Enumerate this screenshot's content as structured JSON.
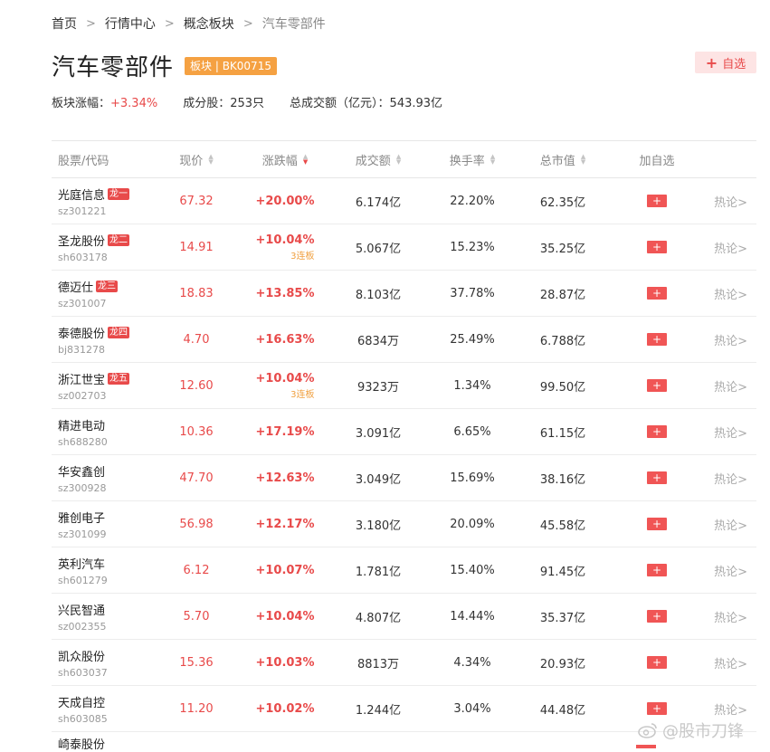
{
  "breadcrumb": [
    {
      "label": "首页"
    },
    {
      "label": "行情中心"
    },
    {
      "label": "概念板块"
    },
    {
      "label": "汽车零部件"
    }
  ],
  "title": "汽车零部件",
  "tag": "板块 | BK00715",
  "add_button": "自选",
  "stats": {
    "change_label": "板块涨幅：",
    "change_value": "+3.34%",
    "components": "成分股：253只",
    "turnover": "总成交额（亿元）：543.93亿"
  },
  "columns": [
    "股票/代码",
    "现价",
    "涨跌幅",
    "成交额",
    "换手率",
    "总市值",
    "加自选"
  ],
  "rows": [
    {
      "name": "光庭信息",
      "code": "sz301221",
      "rank": "龙一",
      "price": "67.32",
      "change": "+20.00%",
      "streak": "",
      "amount": "6.174亿",
      "turnover": "22.20%",
      "mcap": "62.35亿",
      "discuss": "热论"
    },
    {
      "name": "圣龙股份",
      "code": "sh603178",
      "rank": "龙二",
      "price": "14.91",
      "change": "+10.04%",
      "streak": "3连板",
      "amount": "5.067亿",
      "turnover": "15.23%",
      "mcap": "35.25亿",
      "discuss": "热论"
    },
    {
      "name": "德迈仕",
      "code": "sz301007",
      "rank": "龙三",
      "price": "18.83",
      "change": "+13.85%",
      "streak": "",
      "amount": "8.103亿",
      "turnover": "37.78%",
      "mcap": "28.87亿",
      "discuss": "热论"
    },
    {
      "name": "泰德股份",
      "code": "bj831278",
      "rank": "龙四",
      "price": "4.70",
      "change": "+16.63%",
      "streak": "",
      "amount": "6834万",
      "turnover": "25.49%",
      "mcap": "6.788亿",
      "discuss": "热论"
    },
    {
      "name": "浙江世宝",
      "code": "sz002703",
      "rank": "龙五",
      "price": "12.60",
      "change": "+10.04%",
      "streak": "3连板",
      "amount": "9323万",
      "turnover": "1.34%",
      "mcap": "99.50亿",
      "discuss": "热论"
    },
    {
      "name": "精进电动",
      "code": "sh688280",
      "rank": "",
      "price": "10.36",
      "change": "+17.19%",
      "streak": "",
      "amount": "3.091亿",
      "turnover": "6.65%",
      "mcap": "61.15亿",
      "discuss": "热论"
    },
    {
      "name": "华安鑫创",
      "code": "sz300928",
      "rank": "",
      "price": "47.70",
      "change": "+12.63%",
      "streak": "",
      "amount": "3.049亿",
      "turnover": "15.69%",
      "mcap": "38.16亿",
      "discuss": "热论"
    },
    {
      "name": "雅创电子",
      "code": "sz301099",
      "rank": "",
      "price": "56.98",
      "change": "+12.17%",
      "streak": "",
      "amount": "3.180亿",
      "turnover": "20.09%",
      "mcap": "45.58亿",
      "discuss": "热论"
    },
    {
      "name": "英利汽车",
      "code": "sh601279",
      "rank": "",
      "price": "6.12",
      "change": "+10.07%",
      "streak": "",
      "amount": "1.781亿",
      "turnover": "15.40%",
      "mcap": "91.45亿",
      "discuss": "热论"
    },
    {
      "name": "兴民智通",
      "code": "sz002355",
      "rank": "",
      "price": "5.70",
      "change": "+10.04%",
      "streak": "",
      "amount": "4.807亿",
      "turnover": "14.44%",
      "mcap": "35.37亿",
      "discuss": "热论"
    },
    {
      "name": "凯众股份",
      "code": "sh603037",
      "rank": "",
      "price": "15.36",
      "change": "+10.03%",
      "streak": "",
      "amount": "8813万",
      "turnover": "4.34%",
      "mcap": "20.93亿",
      "discuss": "热论"
    },
    {
      "name": "天成自控",
      "code": "sh603085",
      "rank": "",
      "price": "11.20",
      "change": "+10.02%",
      "streak": "",
      "amount": "1.244亿",
      "turnover": "3.04%",
      "mcap": "44.48亿",
      "discuss": "热论"
    }
  ],
  "partial_row_name": "崎泰股份",
  "watermark": "@股市刀锋",
  "colors": {
    "accent_red": "#e84a4a",
    "tag_orange": "#f5a142",
    "streak_orange": "#f0a040"
  }
}
